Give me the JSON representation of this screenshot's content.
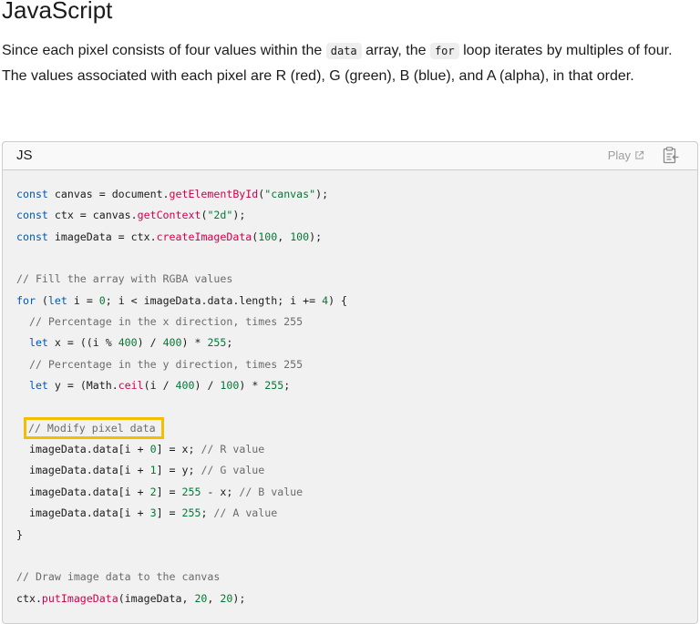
{
  "heading": "JavaScript",
  "paragraph": {
    "part1": "Since each pixel consists of four values within the ",
    "code1": "data",
    "part2": " array, the ",
    "code2": "for",
    "part3": " loop iterates by multiples of four. The values associated with each pixel are R (red), G (green), B (blue), and A (alpha), in that order."
  },
  "code_block": {
    "language_label": "JS",
    "play_label": "Play",
    "icons": {
      "play_external": "external-link-icon",
      "copy": "clipboard-copy-icon"
    },
    "colors": {
      "keyword": "#0057b7",
      "function": "#d1004b",
      "string": "#007936",
      "comment": "#6b6b6b",
      "highlight_border": "#f5bd00"
    },
    "highlighted_line_index": 11,
    "lines": [
      "const canvas = document.getElementById(\"canvas\");",
      "const ctx = canvas.getContext(\"2d\");",
      "const imageData = ctx.createImageData(100, 100);",
      "",
      "// Fill the array with RGBA values",
      "for (let i = 0; i < imageData.data.length; i += 4) {",
      "  // Percentage in the x direction, times 255",
      "  let x = ((i % 400) / 400) * 255;",
      "  // Percentage in the y direction, times 255",
      "  let y = (Math.ceil(i / 400) / 100) * 255;",
      "",
      "  // Modify pixel data",
      "  imageData.data[i + 0] = x; // R value",
      "  imageData.data[i + 1] = y; // G value",
      "  imageData.data[i + 2] = 255 - x; // B value",
      "  imageData.data[i + 3] = 255; // A value",
      "}",
      "",
      "// Draw image data to the canvas",
      "ctx.putImageData(imageData, 20, 20);"
    ]
  }
}
